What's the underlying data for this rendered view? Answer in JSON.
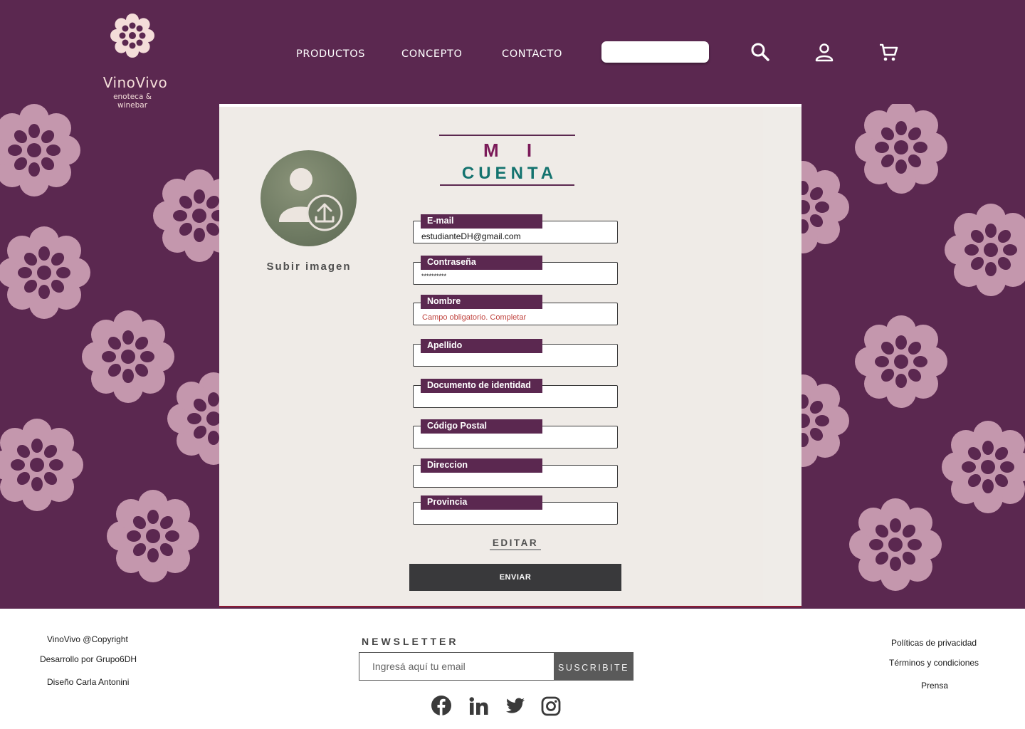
{
  "brand": {
    "name": "VinoVivo",
    "tagline": "enoteca & winebar"
  },
  "nav": {
    "items": [
      {
        "label": "PRODUCTOS"
      },
      {
        "label": "CONCEPTO"
      },
      {
        "label": "CONTACTO"
      }
    ],
    "search_value": "",
    "icons": [
      "search-icon",
      "user-icon",
      "cart-icon"
    ]
  },
  "account": {
    "title_line1": "M I",
    "title_line2": "CUENTA",
    "upload_label": "Subir imagen",
    "fields": [
      {
        "label": "E-mail",
        "value": "estudianteDH@gmail.com",
        "placeholder": ""
      },
      {
        "label": "Contraseña",
        "value": "**********",
        "placeholder": ""
      },
      {
        "label": "Nombre",
        "value": "",
        "placeholder": "Campo obligatorio. Completar"
      },
      {
        "label": "Apellido",
        "value": "",
        "placeholder": ""
      },
      {
        "label": "Documento de identidad",
        "value": "",
        "placeholder": ""
      },
      {
        "label": "Código Postal",
        "value": "",
        "placeholder": ""
      },
      {
        "label": "Direccion",
        "value": "",
        "placeholder": ""
      },
      {
        "label": "Provincia",
        "value": "",
        "placeholder": ""
      }
    ],
    "edit_label": "EDITAR",
    "submit_label": "ENVIAR"
  },
  "footer": {
    "left": [
      "VinoVivo @Copyright",
      "Desarrollo por Grupo6DH",
      "Diseño Carla Antonini"
    ],
    "newsletter_title": "NEWSLETTER",
    "newsletter_placeholder": "Ingresá aquí tu email",
    "newsletter_button": "SUSCRIBITE",
    "social_icons": [
      "facebook-icon",
      "linkedin-icon",
      "twitter-icon",
      "instagram-icon"
    ],
    "right": [
      "Políticas de privacidad",
      "Términos y condiciones",
      "Prensa"
    ]
  },
  "colors": {
    "brand_purple": "#5b2850",
    "title_magenta": "#7b1a59",
    "title_teal": "#14736f",
    "card_bg": "#efebe7",
    "pattern_pink": "#c497ad",
    "error_red": "#c0443f"
  }
}
